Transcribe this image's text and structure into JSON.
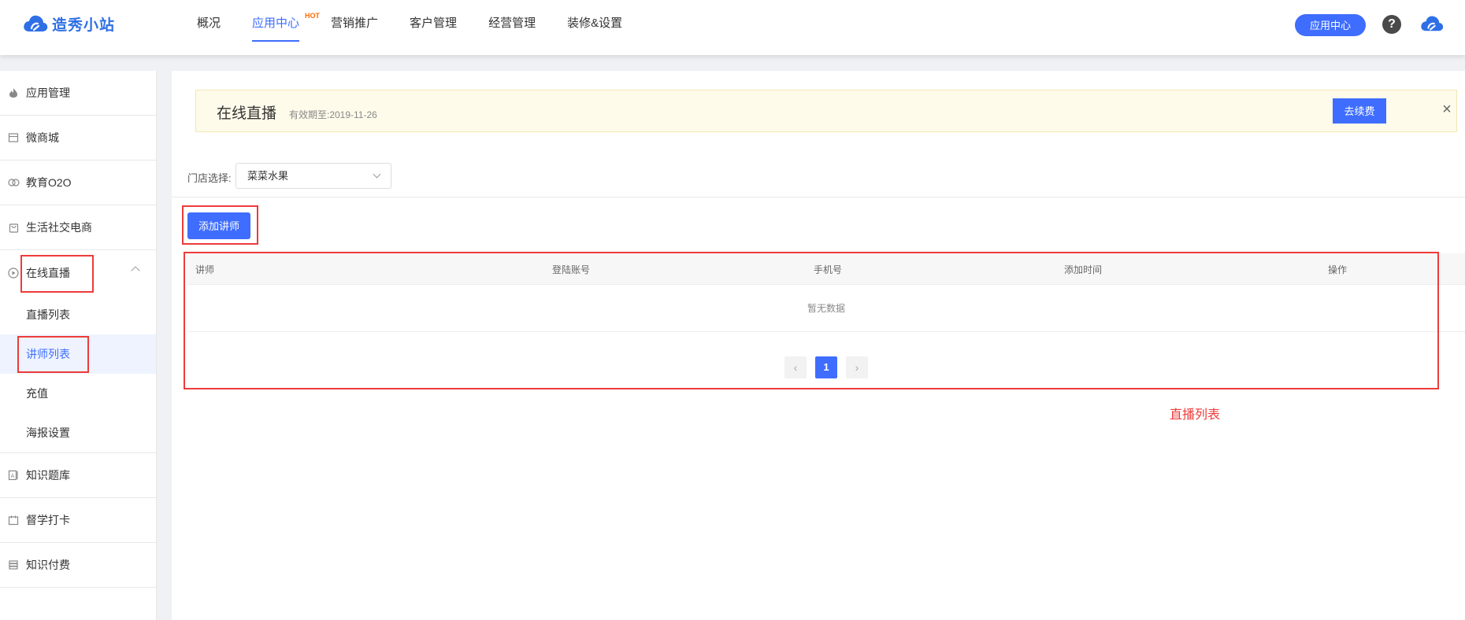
{
  "header": {
    "brand": "造秀小站",
    "nav": [
      {
        "label": "概况",
        "active": false
      },
      {
        "label": "应用中心",
        "active": true,
        "badge": "HOT"
      },
      {
        "label": "营销推广",
        "active": false
      },
      {
        "label": "客户管理",
        "active": false
      },
      {
        "label": "经营管理",
        "active": false
      },
      {
        "label": "装修&设置",
        "active": false
      }
    ],
    "app_center_button": "应用中心",
    "help_glyph": "?"
  },
  "sidebar": {
    "items": [
      {
        "label": "应用管理",
        "icon": "flame-icon"
      },
      {
        "label": "微商城",
        "icon": "store-icon"
      },
      {
        "label": "教育O2O",
        "icon": "education-icon"
      },
      {
        "label": "生活社交电商",
        "icon": "bag-icon"
      },
      {
        "label": "在线直播",
        "icon": "play-circle-icon"
      },
      {
        "label": "知识题库",
        "icon": "question-bank-icon"
      },
      {
        "label": "督学打卡",
        "icon": "calendar-icon"
      },
      {
        "label": "知识付费",
        "icon": "stack-icon"
      }
    ],
    "live_submenu": [
      "直播列表",
      "讲师列表",
      "充值",
      "海报设置"
    ],
    "active_submenu": "讲师列表"
  },
  "banner": {
    "title": "在线直播",
    "expiry": "有效期至:2019-11-26",
    "renew_button": "去续费",
    "close_glyph": "×"
  },
  "filter": {
    "store_label": "门店选择:",
    "store_value": "菜菜水果"
  },
  "toolbar": {
    "add_lecturer_button": "添加讲师"
  },
  "table": {
    "columns": [
      "讲师",
      "登陆账号",
      "手机号",
      "添加时间",
      "操作"
    ],
    "empty_text": "暂无数据"
  },
  "pagination": {
    "prev": "‹",
    "current": "1",
    "next": "›"
  },
  "annotation": {
    "note": "直播列表"
  },
  "colors": {
    "accent": "#3e6dff",
    "annotation_red": "#ee3b3b",
    "banner_bg": "#fefbea"
  }
}
